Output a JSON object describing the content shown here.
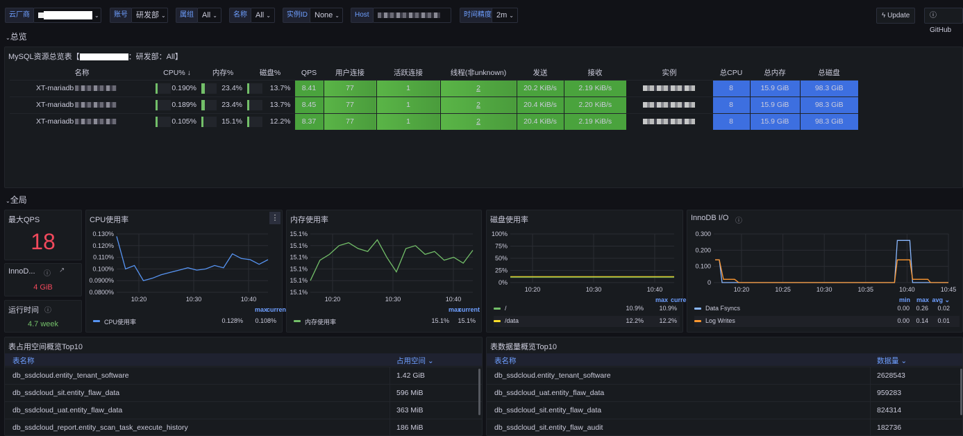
{
  "toolbar": {
    "vendor_label": "云厂商",
    "account_label": "账号",
    "account_value": "研发部",
    "group_label": "属组",
    "group_value": "All",
    "name_label": "名称",
    "name_value": "All",
    "instance_label": "实例ID",
    "instance_value": "None",
    "host_label": "Host",
    "time_label": "时间精度",
    "time_value": "2m",
    "update_label": "Update",
    "github_label": "GitHub"
  },
  "rows": {
    "overview": "总览",
    "global": "全局"
  },
  "overview": {
    "title_prefix": "MySQL资源总览表【",
    "title_suffix": "：研发部：All】",
    "headers": [
      "名称",
      "CPU% ↓",
      "内存%",
      "磁盘%",
      "QPS",
      "用户连接",
      "活跃连接",
      "线程(非unknown)",
      "发送",
      "接收",
      "实例",
      "总CPU",
      "总内存",
      "总磁盘"
    ],
    "rows": [
      {
        "name": "XT-mariadb",
        "cpu": "0.190%",
        "cpu_pct": 0.19,
        "mem": "23.4%",
        "mem_pct": 23.4,
        "disk": "13.7%",
        "disk_pct": 13.7,
        "qps": "8.41",
        "user_conn": "77",
        "active_conn": "1",
        "threads": "2",
        "sent": "20.2 KiB/s",
        "recv": "2.19 KiB/s",
        "total_cpu": "8",
        "total_mem": "15.9 GiB",
        "total_disk": "98.3 GiB"
      },
      {
        "name": "XT-mariadb",
        "cpu": "0.189%",
        "cpu_pct": 0.189,
        "mem": "23.4%",
        "mem_pct": 23.4,
        "disk": "13.7%",
        "disk_pct": 13.7,
        "qps": "8.45",
        "user_conn": "77",
        "active_conn": "1",
        "threads": "2",
        "sent": "20.4 KiB/s",
        "recv": "2.20 KiB/s",
        "total_cpu": "8",
        "total_mem": "15.9 GiB",
        "total_disk": "98.3 GiB"
      },
      {
        "name": "XT-mariadb",
        "cpu": "0.105%",
        "cpu_pct": 0.105,
        "mem": "15.1%",
        "mem_pct": 15.1,
        "disk": "12.2%",
        "disk_pct": 12.2,
        "qps": "8.37",
        "user_conn": "77",
        "active_conn": "1",
        "threads": "2",
        "sent": "20.4 KiB/s",
        "recv": "2.19 KiB/s",
        "total_cpu": "8",
        "total_mem": "15.9 GiB",
        "total_disk": "98.3 GiB"
      }
    ]
  },
  "stats": {
    "max_qps_title": "最大QPS",
    "max_qps_value": "18",
    "innodb_title": "InnoD...",
    "innodb_value": "4 GiB",
    "uptime_title": "运行时间",
    "uptime_value": "4.7 week"
  },
  "chart_data": [
    {
      "type": "line",
      "title": "CPU使用率",
      "x": [
        "10:12",
        "10:14",
        "10:16",
        "10:18",
        "10:20",
        "10:22",
        "10:24",
        "10:26",
        "10:28",
        "10:30",
        "10:32",
        "10:34",
        "10:36",
        "10:38",
        "10:40",
        "10:42",
        "10:44",
        "10:46"
      ],
      "yticks": [
        "0.130%",
        "0.120%",
        "0.110%",
        "0.100%",
        "0.0900%",
        "0.0800%"
      ],
      "ylim": [
        0.08,
        0.13
      ],
      "xticks": [
        "10:20",
        "10:30",
        "10:40"
      ],
      "series": [
        {
          "name": "CPU使用率",
          "values": [
            0.128,
            0.1,
            0.103,
            0.09,
            0.092,
            0.095,
            0.097,
            0.099,
            0.101,
            0.099,
            0.1,
            0.103,
            0.101,
            0.113,
            0.109,
            0.108,
            0.104,
            0.108
          ],
          "max": "0.128%",
          "current": "0.108%",
          "color": "#5794f2"
        }
      ],
      "legend_cols": [
        "max",
        "current"
      ]
    },
    {
      "type": "line",
      "title": "内存使用率",
      "x": [
        "10:12",
        "10:14",
        "10:16",
        "10:18",
        "10:20",
        "10:22",
        "10:24",
        "10:26",
        "10:28",
        "10:30",
        "10:32",
        "10:34",
        "10:36",
        "10:38",
        "10:40",
        "10:42",
        "10:44",
        "10:46"
      ],
      "yticks": [
        "15.1%",
        "15.1%",
        "15.1%",
        "15.1%",
        "15.1%",
        "15.1%"
      ],
      "ylim": [
        0,
        1
      ],
      "xticks": [
        "10:20",
        "10:30",
        "10:40"
      ],
      "series": [
        {
          "name": "内存使用率",
          "values": [
            0.2,
            0.55,
            0.65,
            0.8,
            0.85,
            0.75,
            0.7,
            0.9,
            0.6,
            0.35,
            0.75,
            0.8,
            0.65,
            0.7,
            0.55,
            0.6,
            0.5,
            0.72
          ],
          "max": "15.1%",
          "current": "15.1%",
          "color": "#73bf69"
        }
      ],
      "legend_cols": [
        "max",
        "current"
      ]
    },
    {
      "type": "line",
      "title": "磁盘使用率",
      "x": [
        "10:12",
        "10:46"
      ],
      "yticks": [
        "100%",
        "75%",
        "50%",
        "25%",
        "0%"
      ],
      "ylim": [
        0,
        100
      ],
      "xticks": [
        "10:20",
        "10:30",
        "10:40"
      ],
      "series": [
        {
          "name": "/",
          "values": [
            10.9,
            10.9
          ],
          "max": "10.9%",
          "current": "10.9%",
          "color": "#73bf69"
        },
        {
          "name": "/data",
          "values": [
            12.2,
            12.2
          ],
          "max": "12.2%",
          "current": "12.2%",
          "color": "#fade2a"
        }
      ],
      "legend_cols": [
        "max",
        "current"
      ]
    },
    {
      "type": "line",
      "title": "InnoDB I/O",
      "x": [
        "10:15",
        "10:20",
        "10:25",
        "10:30",
        "10:35",
        "10:40",
        "10:45"
      ],
      "yticks": [
        "0.300",
        "0.200",
        "0.100",
        "0"
      ],
      "ylim": [
        0,
        0.3
      ],
      "xticks": [
        "10:20",
        "10:25",
        "10:30",
        "10:35",
        "10:40",
        "10:45"
      ],
      "series": [
        {
          "name": "Data Fsyncs",
          "min": "0.00",
          "max": "0.26",
          "avg": "0.02",
          "color": "#8ab8ff"
        },
        {
          "name": "Log Writes",
          "min": "0.00",
          "max": "0.14",
          "avg": "0.01",
          "color": "#ff9830"
        }
      ],
      "legend_cols": [
        "min",
        "max",
        "avg ⌄"
      ]
    }
  ],
  "space_table": {
    "title": "表占用空间概览Top10",
    "col_name": "表名称",
    "col_value": "占用空间 ⌄",
    "rows": [
      {
        "name": "db_ssdcloud.entity_tenant_software",
        "value": "1.42 GiB"
      },
      {
        "name": "db_ssdcloud_sit.entity_flaw_data",
        "value": "596 MiB"
      },
      {
        "name": "db_ssdcloud_uat.entity_flaw_data",
        "value": "363 MiB"
      },
      {
        "name": "db_ssdcloud_report.entity_scan_task_execute_history",
        "value": "186 MiB"
      }
    ]
  },
  "count_table": {
    "title": "表数据量概览Top10",
    "col_name": "表名称",
    "col_value": "数据量 ⌄",
    "rows": [
      {
        "name": "db_ssdcloud.entity_tenant_software",
        "value": "2628543"
      },
      {
        "name": "db_ssdcloud_uat.entity_flaw_data",
        "value": "959283"
      },
      {
        "name": "db_ssdcloud_sit.entity_flaw_data",
        "value": "824314"
      },
      {
        "name": "db_ssdcloud_sit.entity_flaw_audit",
        "value": "182736"
      }
    ]
  }
}
